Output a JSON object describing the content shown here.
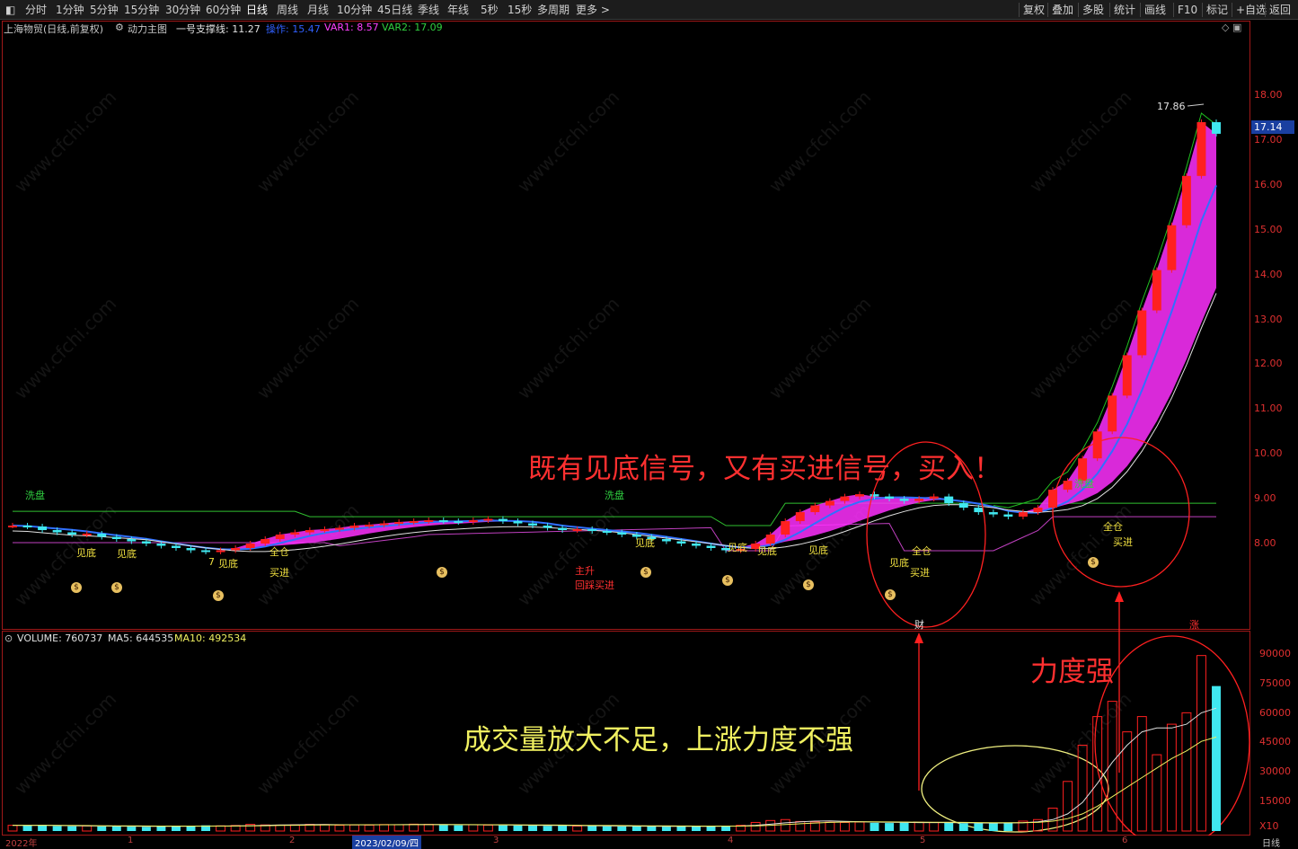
{
  "toolbar": {
    "periods": [
      "分时",
      "1分钟",
      "5分钟",
      "15分钟",
      "30分钟",
      "60分钟",
      "日线",
      "周线",
      "月线",
      "10分钟",
      "45日线",
      "季线",
      "年线",
      "5秒",
      "15秒",
      "多周期",
      "更多 >"
    ],
    "active_period": "日线",
    "right_buttons": [
      "复权",
      "叠加",
      "多股",
      "统计",
      "画线",
      "F10",
      "标记",
      "+自选",
      "返回"
    ]
  },
  "price_header": {
    "stock": "上海物贸(日线,前复权)",
    "indicator": "动力主图",
    "support_label": "一号支撑线: 11.27",
    "op_label": "操作: 15.47",
    "var1_label": "VAR1: 8.57",
    "var2_label": "VAR2: 17.09"
  },
  "volume_header": {
    "volume": "VOLUME: 760737",
    "ma5": "MA5: 644535",
    "ma10": "MA10: 492534"
  },
  "price_axis": [
    "18.00",
    "17.00",
    "16.00",
    "15.00",
    "14.00",
    "13.00",
    "12.00",
    "11.00",
    "10.00",
    "9.00",
    "8.00"
  ],
  "volume_axis": [
    "90000",
    "75000",
    "60000",
    "45000",
    "30000",
    "15000",
    "X10"
  ],
  "last_price": "17.14",
  "max_price_label": "17.86",
  "date_axis": {
    "labels": [
      "2022年",
      "1",
      "2",
      "2023/02/09/四",
      "3",
      "4",
      "5",
      "6"
    ],
    "period_label": "日线"
  },
  "signals": {
    "jiandi": "见底",
    "quancang": "全仓",
    "mairu": "买进",
    "xipan": "洗盘",
    "zhusheng": "主升",
    "huicai": "回踩买进",
    "cai": "财",
    "zhang": "涨",
    "mark7": "7"
  },
  "annotations": {
    "buy_signal": "既有见底信号，又有买进信号，买入！",
    "volume_weak": "成交量放大不足，上涨力度不强",
    "strength": "力度强"
  },
  "watermark": "www.cfchi.com",
  "colors": {
    "up": "#ff2020",
    "down": "#40e8f0",
    "ribbon": "#ff30ff",
    "support_green": "#30c030",
    "support_purple": "#c040c0",
    "ma_white": "#e0e0e0",
    "panel_border": "#a01818",
    "annot_red": "#ff3030",
    "annot_yellow": "#f0f060"
  },
  "chart_data": {
    "type": "candlestick",
    "price_ylim": [
      7.0,
      18.5
    ],
    "closes": [
      8.4,
      8.38,
      8.3,
      8.25,
      8.2,
      8.22,
      8.15,
      8.1,
      8.05,
      8.0,
      7.95,
      7.9,
      7.85,
      7.82,
      7.85,
      7.9,
      8.0,
      8.1,
      8.2,
      8.25,
      8.3,
      8.32,
      8.35,
      8.4,
      8.42,
      8.45,
      8.48,
      8.5,
      8.52,
      8.5,
      8.48,
      8.52,
      8.55,
      8.5,
      8.45,
      8.4,
      8.35,
      8.3,
      8.32,
      8.28,
      8.25,
      8.2,
      8.15,
      8.1,
      8.05,
      8.0,
      7.95,
      7.9,
      7.85,
      7.88,
      8.0,
      8.2,
      8.5,
      8.7,
      8.85,
      8.95,
      9.05,
      9.1,
      9.05,
      9.0,
      8.95,
      9.0,
      9.05,
      8.9,
      8.8,
      8.7,
      8.65,
      8.6,
      8.7,
      8.8,
      9.2,
      9.4,
      9.9,
      10.5,
      11.3,
      12.2,
      13.2,
      14.1,
      15.1,
      16.2,
      17.4,
      17.14
    ],
    "volumes": [
      3000,
      2800,
      3200,
      2600,
      2500,
      2700,
      2400,
      2600,
      2300,
      2200,
      2500,
      2800,
      2600,
      3000,
      2700,
      2900,
      3500,
      3200,
      3100,
      3300,
      3500,
      3400,
      3000,
      3200,
      3100,
      3400,
      3300,
      3600,
      3500,
      3200,
      3000,
      3300,
      3100,
      3000,
      2900,
      2800,
      2700,
      2800,
      2600,
      2700,
      2500,
      2400,
      2600,
      2500,
      2300,
      2400,
      2600,
      2500,
      2700,
      3000,
      4500,
      5500,
      6000,
      5000,
      4800,
      4600,
      4500,
      4700,
      4300,
      4200,
      4400,
      4600,
      4500,
      4300,
      4100,
      4000,
      4300,
      4500,
      5200,
      6000,
      12000,
      26000,
      45000,
      60000,
      68000,
      52000,
      60000,
      40000,
      56000,
      62000,
      92000,
      76000
    ],
    "ma5": [
      3000,
      2950,
      3000,
      2900,
      2800,
      2700,
      2650,
      2600,
      2550,
      2500,
      2450,
      2500,
      2550,
      2600,
      2650,
      2700,
      2800,
      3000,
      3150,
      3250,
      3350,
      3400,
      3300,
      3250,
      3250,
      3300,
      3350,
      3400,
      3450,
      3400,
      3350,
      3300,
      3250,
      3200,
      3100,
      3000,
      2950,
      2900,
      2850,
      2800,
      2750,
      2650,
      2600,
      2550,
      2500,
      2450,
      2450,
      2500,
      2550,
      2650,
      3000,
      3600,
      4300,
      4800,
      5200,
      5300,
      5100,
      4900,
      4700,
      4550,
      4500,
      4450,
      4450,
      4450,
      4350,
      4250,
      4200,
      4250,
      4400,
      4800,
      6000,
      9000,
      15000,
      25000,
      36000,
      45000,
      52000,
      54000,
      54000,
      56000,
      62000,
      64453
    ],
    "ma10": [
      3000,
      3000,
      3000,
      2950,
      2900,
      2850,
      2800,
      2750,
      2700,
      2650,
      2600,
      2600,
      2600,
      2600,
      2600,
      2650,
      2700,
      2800,
      2900,
      3000,
      3100,
      3200,
      3250,
      3300,
      3300,
      3300,
      3300,
      3350,
      3350,
      3350,
      3350,
      3350,
      3300,
      3300,
      3250,
      3200,
      3150,
      3100,
      3000,
      2950,
      2900,
      2850,
      2800,
      2750,
      2700,
      2650,
      2600,
      2600,
      2600,
      2600,
      2700,
      3000,
      3400,
      3800,
      4200,
      4500,
      4700,
      4800,
      4800,
      4750,
      4700,
      4650,
      4600,
      4550,
      4500,
      4450,
      4400,
      4350,
      4400,
      4500,
      5200,
      6500,
      9000,
      13000,
      18000,
      23000,
      28000,
      33000,
      38000,
      42000,
      47000,
      49253
    ]
  }
}
